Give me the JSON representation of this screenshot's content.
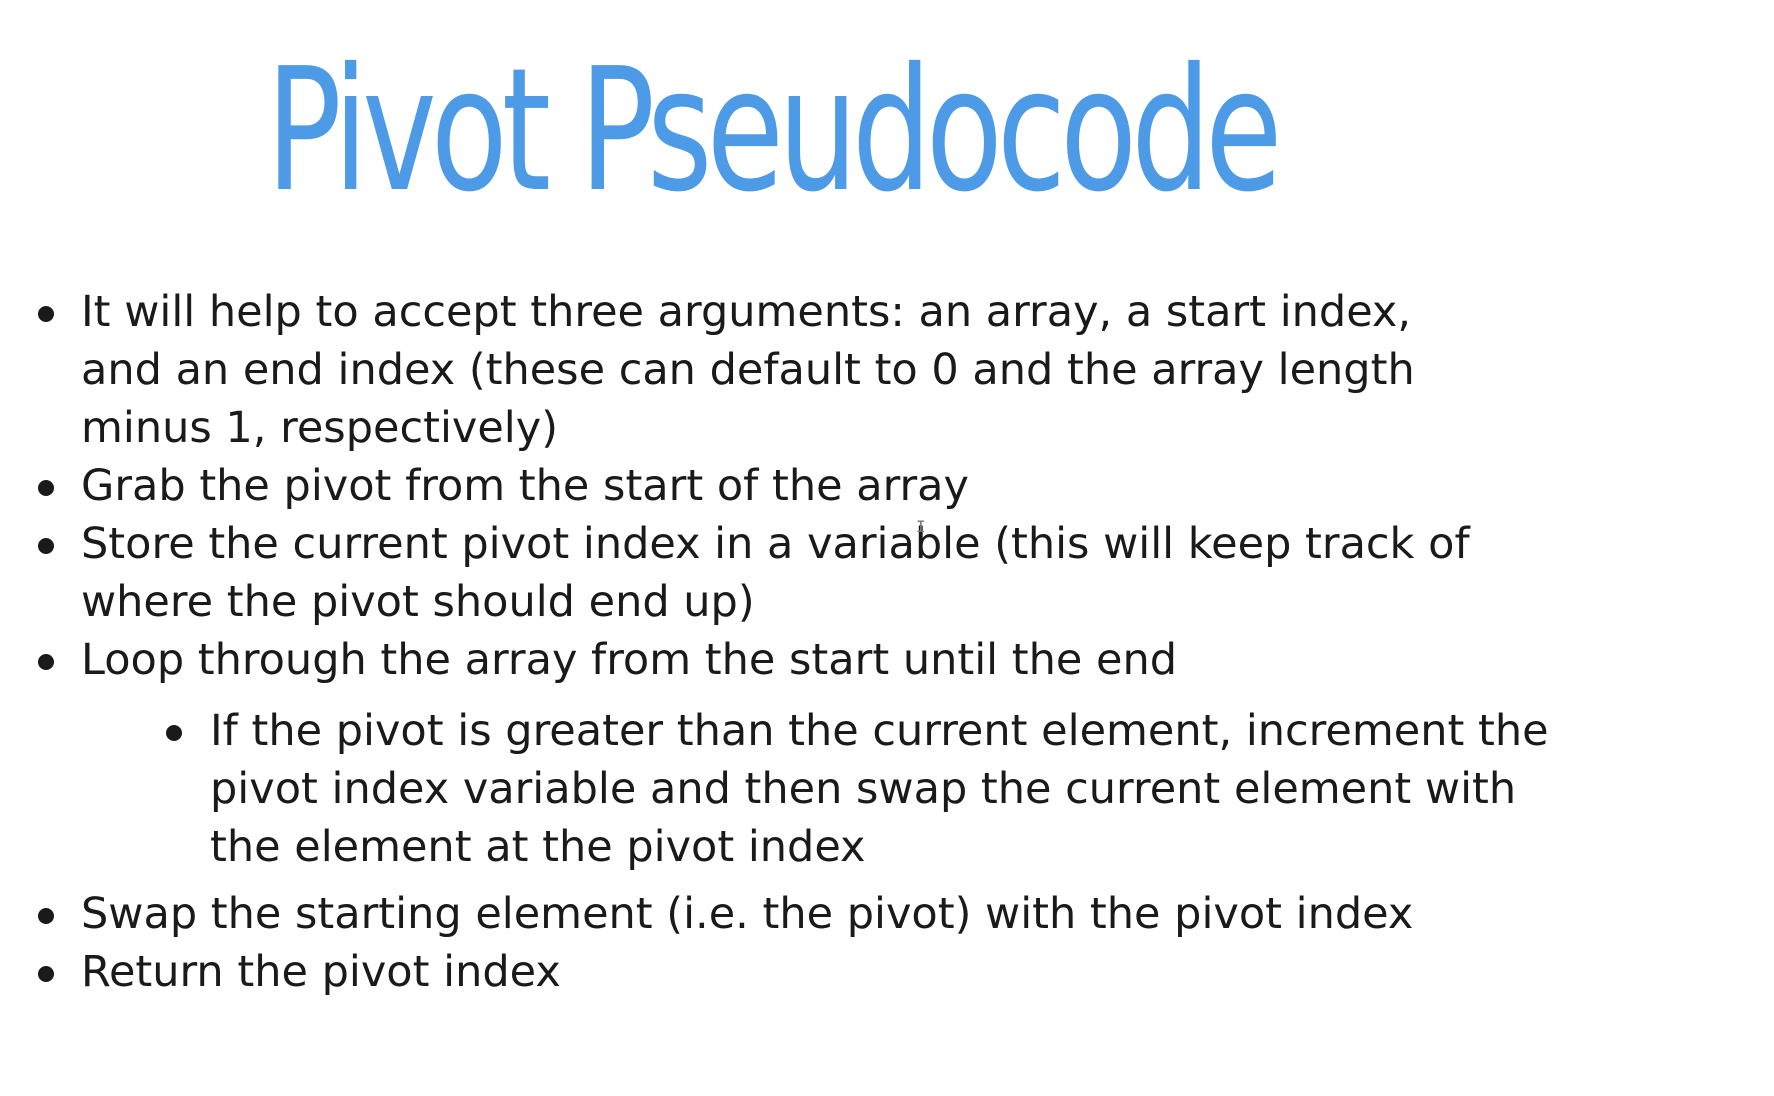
{
  "title": "Pivot Pseudocode",
  "bullets": [
    {
      "lines": [
        "It will help to accept three arguments: an array, a start index,",
        "and an end index (these can default to 0 and the array length",
        "minus 1, respectively)"
      ]
    },
    {
      "lines": [
        "Grab the pivot from the start of the array"
      ]
    },
    {
      "lines": [
        "Store the current pivot index in a variable (this will keep track of",
        "where the pivot should end up)"
      ]
    },
    {
      "lines": [
        "Loop through the array from the start until the end"
      ]
    },
    {
      "lines": [
        "If the pivot is greater than the current element, increment the",
        "pivot index variable and then swap the current element with",
        "the element at the pivot index"
      ]
    },
    {
      "lines": [
        "Swap the starting element (i.e. the pivot) with the pivot index"
      ]
    },
    {
      "lines": [
        "Return the pivot index"
      ]
    }
  ],
  "cursor": "I"
}
